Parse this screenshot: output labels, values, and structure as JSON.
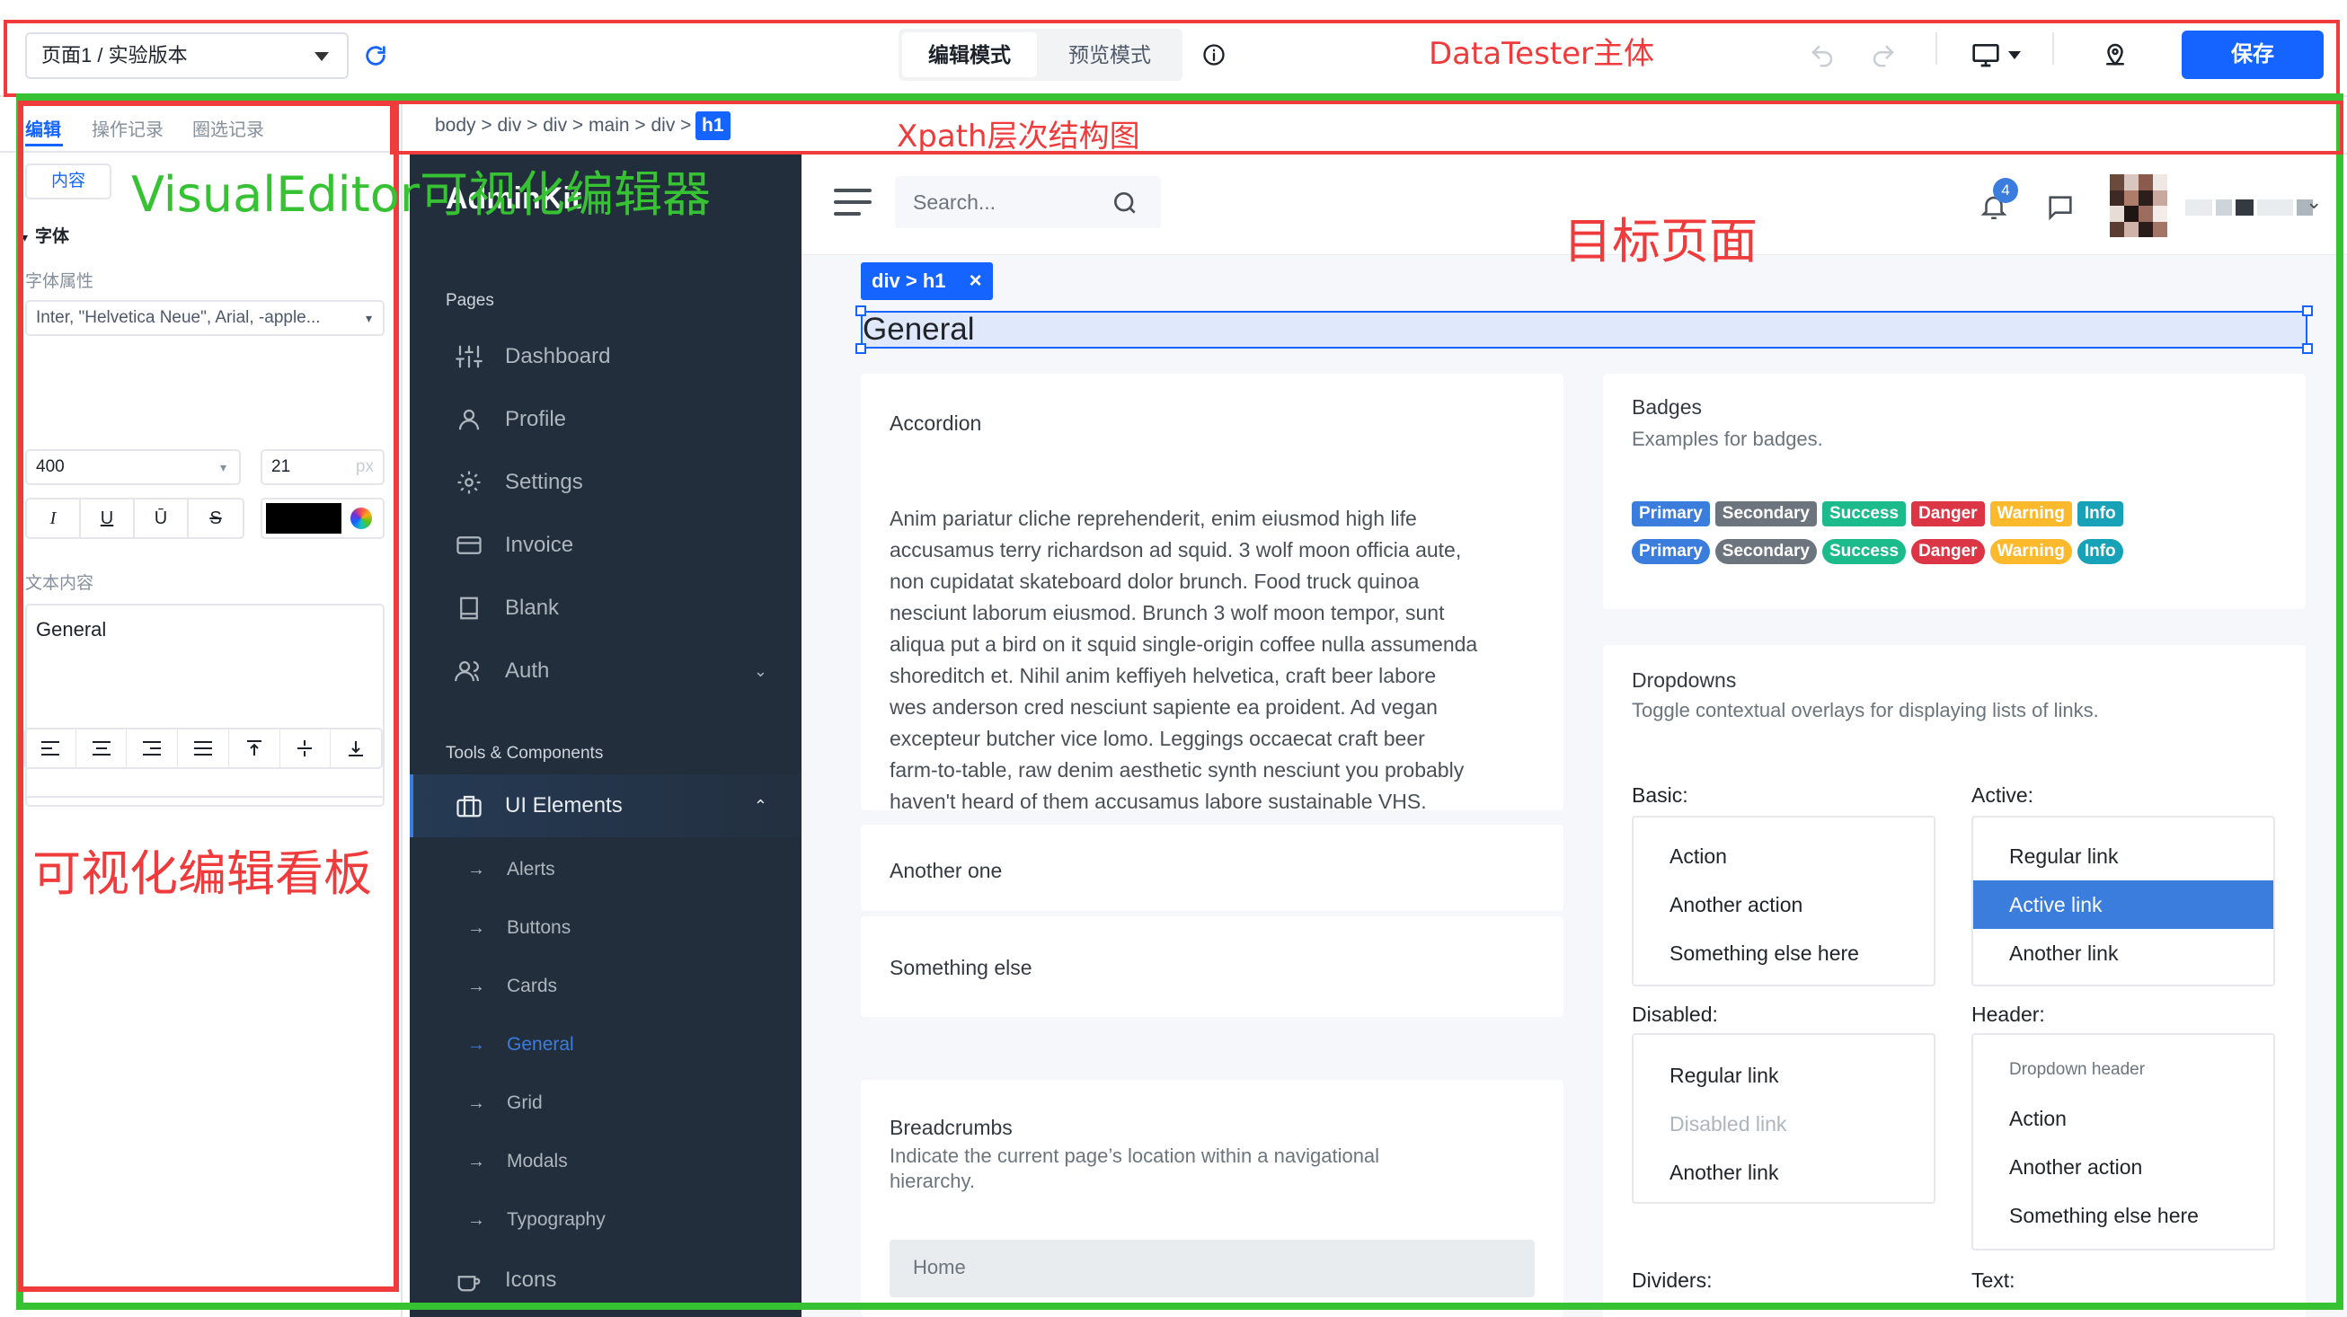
{
  "topbar": {
    "page_select": "页面1 / 实验版本",
    "mode_edit": "编辑模式",
    "mode_preview": "预览模式",
    "save": "保存"
  },
  "annotations": {
    "datatester": "DataTester主体",
    "visualeditor": "VisualEditor可视化编辑器",
    "xpath": "Xpath层次结构图",
    "target": "目标页面",
    "board": "可视化编辑看板"
  },
  "editor": {
    "tabs": [
      "编辑",
      "操作记录",
      "圈选记录"
    ],
    "content_tab": "内容",
    "section_font": "字体",
    "font_props_label": "字体属性",
    "font_family": "Inter, \"Helvetica Neue\", Arial, -apple...",
    "font_weight": "400",
    "font_size": "21",
    "font_size_unit": "px",
    "text_color": "#000000",
    "text_content_label": "文本内容",
    "text_content": "General",
    "format": [
      "I",
      "U",
      "Ū",
      "S"
    ]
  },
  "xpath": {
    "path": "body > div > div > main > div >",
    "current": "h1"
  },
  "sidebar": {
    "brand": "AdminKit",
    "section_pages": "Pages",
    "pages": [
      {
        "label": "Dashboard",
        "icon": "sliders-icon"
      },
      {
        "label": "Profile",
        "icon": "user-icon"
      },
      {
        "label": "Settings",
        "icon": "gear-icon"
      },
      {
        "label": "Invoice",
        "icon": "credit-card-icon"
      },
      {
        "label": "Blank",
        "icon": "book-icon"
      },
      {
        "label": "Auth",
        "icon": "users-icon"
      }
    ],
    "section_tools": "Tools & Components",
    "ui_elements": "UI Elements",
    "sub_items": [
      "Alerts",
      "Buttons",
      "Cards",
      "General",
      "Grid",
      "Modals",
      "Typography"
    ],
    "icons_item": "Icons",
    "active_color": "#3b7ddd"
  },
  "navbar": {
    "search_placeholder": "Search...",
    "notification_count": "4"
  },
  "selection": {
    "tag": "div > h1",
    "heading": "General"
  },
  "accordion": {
    "title": "Accordion",
    "body": [
      "Anim pariatur cliche reprehenderit, enim eiusmod high life",
      "accusamus terry richardson ad squid. 3 wolf moon officia aute,",
      "non cupidatat skateboard dolor brunch. Food truck quinoa",
      "nesciunt laborum eiusmod. Brunch 3 wolf moon tempor, sunt",
      "aliqua put a bird on it squid single-origin coffee nulla assumenda",
      "shoreditch et. Nihil anim keffiyeh helvetica, craft beer labore",
      "wes anderson cred nesciunt sapiente ea proident. Ad vegan",
      "excepteur butcher vice lomo. Leggings occaecat craft beer",
      "farm-to-table, raw denim aesthetic synth nesciunt you probably",
      "haven't heard of them accusamus labore sustainable VHS."
    ],
    "another": "Another one",
    "else": "Something else"
  },
  "breadcrumbs": {
    "title": "Breadcrumbs",
    "subtitle_1": "Indicate the current page’s location within a navigational",
    "subtitle_2": "hierarchy.",
    "home": "Home"
  },
  "badges": {
    "title": "Badges",
    "subtitle": "Examples for badges.",
    "row1": [
      {
        "label": "Primary",
        "color": "#3b7ddd"
      },
      {
        "label": "Secondary",
        "color": "#6c757d"
      },
      {
        "label": "Success",
        "color": "#1cbb8c"
      },
      {
        "label": "Danger",
        "color": "#dc3545"
      },
      {
        "label": "Warning",
        "color": "#fcb92c"
      },
      {
        "label": "Info",
        "color": "#17a2b8"
      }
    ],
    "row2": [
      {
        "label": "Primary",
        "color": "#3b7ddd"
      },
      {
        "label": "Secondary",
        "color": "#6c757d"
      },
      {
        "label": "Success",
        "color": "#1cbb8c"
      },
      {
        "label": "Danger",
        "color": "#dc3545"
      },
      {
        "label": "Warning",
        "color": "#fcb92c"
      },
      {
        "label": "Info",
        "color": "#17a2b8"
      }
    ]
  },
  "dropdowns": {
    "title": "Dropdowns",
    "subtitle": "Toggle contextual overlays for displaying lists of links.",
    "basic_label": "Basic:",
    "basic": [
      "Action",
      "Another action",
      "Something else here"
    ],
    "active_label": "Active:",
    "active": [
      "Regular link",
      "Active link",
      "Another link"
    ],
    "disabled_label": "Disabled:",
    "disabled": [
      "Regular link",
      "Disabled link",
      "Another link"
    ],
    "header_label": "Header:",
    "header_title": "Dropdown header",
    "header_items": [
      "Action",
      "Another action",
      "Something else here"
    ],
    "dividers_label": "Dividers:",
    "text_label": "Text:"
  }
}
